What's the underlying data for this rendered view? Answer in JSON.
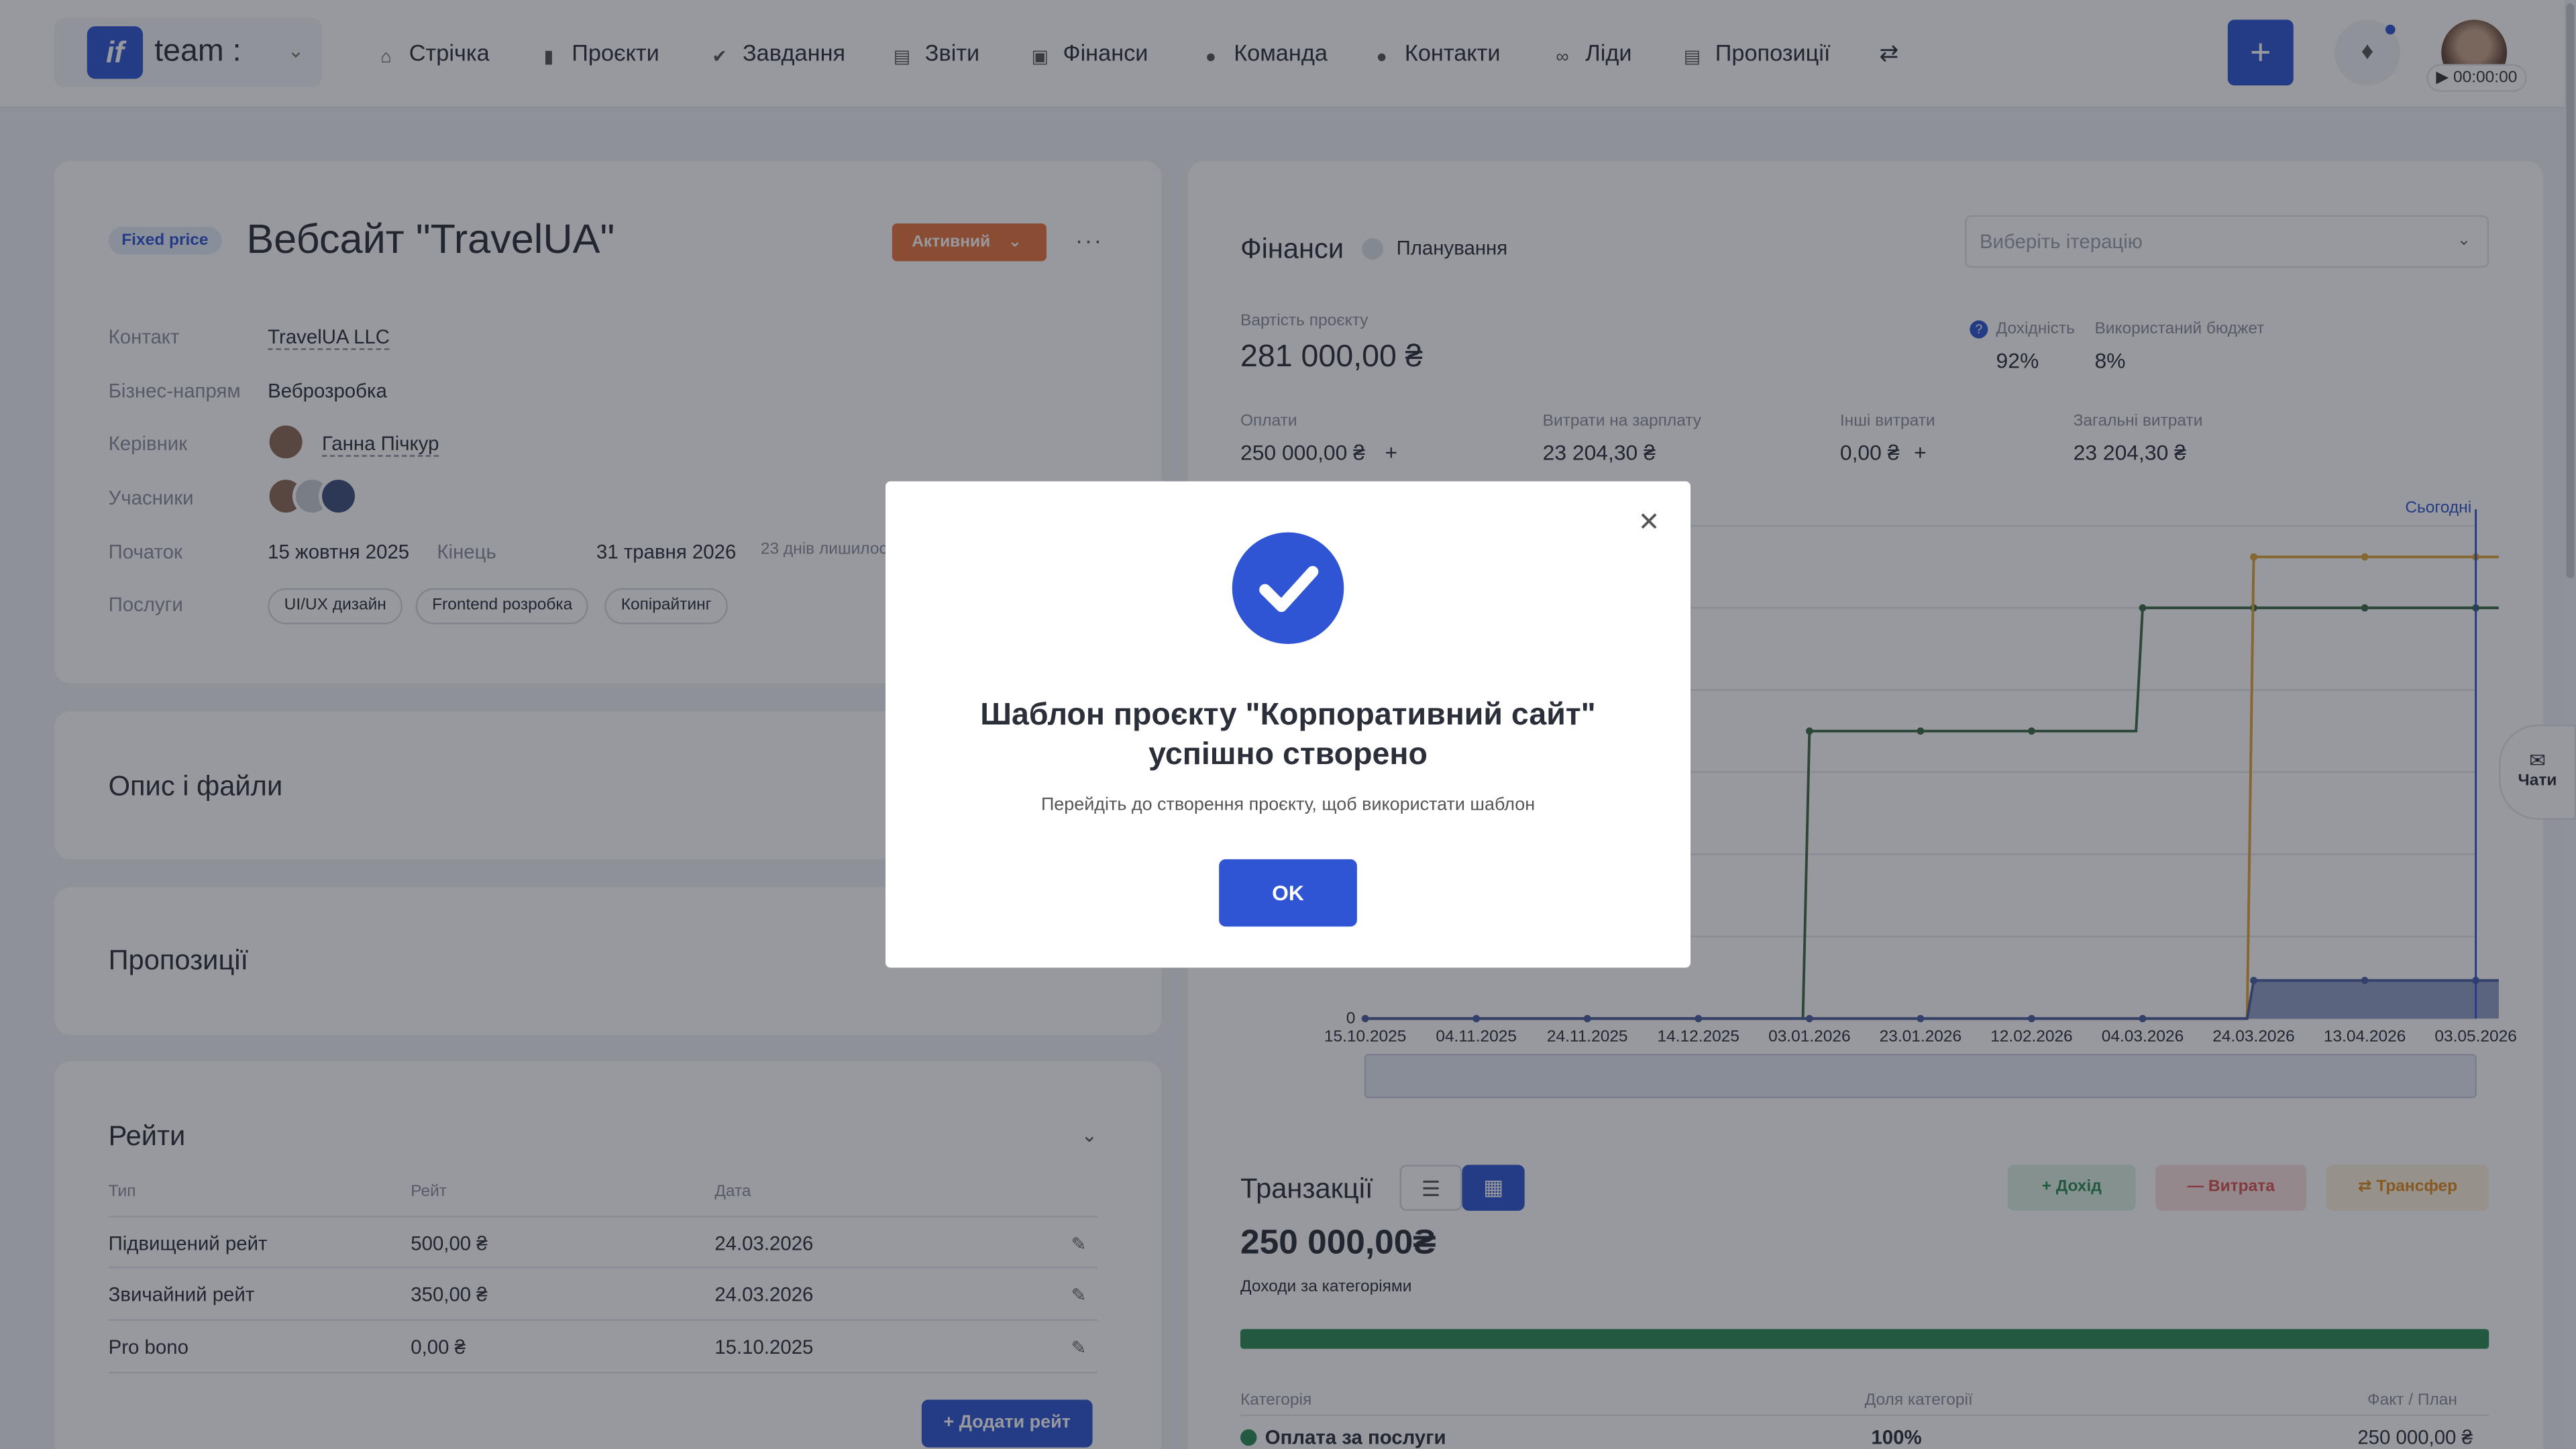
{
  "topbar": {
    "workspace": "team :",
    "logo": "if",
    "nav": [
      "Стрічка",
      "Проєкти",
      "Завдання",
      "Звіти",
      "Фінанси",
      "Команда",
      "Контакти",
      "Ліди",
      "Пропозиції"
    ],
    "timer": "00:00:00"
  },
  "project": {
    "badge": "Fixed price",
    "title": "Вебсайт \"TravelUA\"",
    "status": "Активний",
    "fields": {
      "contact_label": "Контакт",
      "contact": "TravelUA LLC",
      "direction_label": "Бізнес-напрям",
      "direction": "Веброзробка",
      "manager_label": "Керівник",
      "manager": "Ганна Пічкур",
      "members_label": "Учасники",
      "start_label": "Початок",
      "start": "15 жовтня 2025",
      "end_label": "Кінець",
      "end": "31 травня 2026",
      "days_left": "23 днів лишилося",
      "services_label": "Послуги"
    },
    "services": [
      "UI/UX дизайн",
      "Frontend розробка",
      "Копірайтинг"
    ]
  },
  "sections": {
    "description": "Опис і файли",
    "proposals": "Пропозиції",
    "rates": "Рейти"
  },
  "rates": {
    "headers": [
      "Тип",
      "Рейт",
      "Дата"
    ],
    "rows": [
      [
        "Підвищений рейт",
        "500,00 ₴",
        "24.03.2026"
      ],
      [
        "Звичайний рейт",
        "350,00 ₴",
        "24.03.2026"
      ],
      [
        "Pro bono",
        "0,00 ₴",
        "15.10.2025"
      ]
    ],
    "add_button": "+ Додати рейт"
  },
  "finance": {
    "title": "Фінанси",
    "planning": "Планування",
    "iteration_placeholder": "Виберіть ітерацію",
    "cost_label": "Вартість проєкту",
    "cost": "281 000,00 ₴",
    "profit_label": "Дохідність",
    "profit": "92%",
    "budget_label": "Використаний бюджет",
    "budget": "8%",
    "payments_label": "Оплати",
    "payments": "250 000,00 ₴",
    "salary_label": "Витрати на зарплату",
    "salary": "23 204,30 ₴",
    "other_label": "Інші витрати",
    "other": "0,00 ₴",
    "total_label": "Загальні витрати",
    "total": "23 204,30 ₴",
    "today": "Сьогодні"
  },
  "chart_data": {
    "type": "line",
    "x": [
      "15.10.2025",
      "04.11.2025",
      "24.11.2025",
      "14.12.2025",
      "03.01.2026",
      "23.01.2026",
      "12.02.2026",
      "04.03.2026",
      "24.03.2026",
      "13.04.2026",
      "03.05.2026"
    ],
    "y_tick": "0",
    "series": [
      {
        "color": "#3d6b45",
        "values": [
          0,
          0,
          0,
          0,
          175000,
          175000,
          175000,
          250000,
          250000,
          250000,
          250000
        ]
      },
      {
        "color": "#e0a43a",
        "values": [
          0,
          0,
          0,
          0,
          0,
          0,
          0,
          0,
          281000,
          281000,
          281000
        ]
      },
      {
        "color": "#4a5ea0",
        "values": [
          0,
          0,
          0,
          0,
          0,
          0,
          0,
          0,
          23204,
          23204,
          23204
        ]
      }
    ]
  },
  "transactions": {
    "title": "Транзакції",
    "income_btn": "Дохід",
    "expense_btn": "Витрата",
    "transfer_btn": "Трансфер",
    "sum": "250 000,00₴",
    "sub": "Доходи за категоріями",
    "headers": [
      "Категорія",
      "Доля категорії",
      "Факт / План"
    ],
    "row": [
      "Оплата за послуги",
      "100%",
      "250 000,00 ₴"
    ]
  },
  "chats": "Чати",
  "modal": {
    "title_line1": "Шаблон проєкту \"Корпоративний сайт\"",
    "title_line2": "успішно створено",
    "subtitle": "Перейдіть до створення проєкту, щоб використати шаблон",
    "ok": "OK"
  },
  "colors": {
    "primary": "#2f55d4",
    "status": "#e8743b",
    "income": "#2e8b57"
  }
}
